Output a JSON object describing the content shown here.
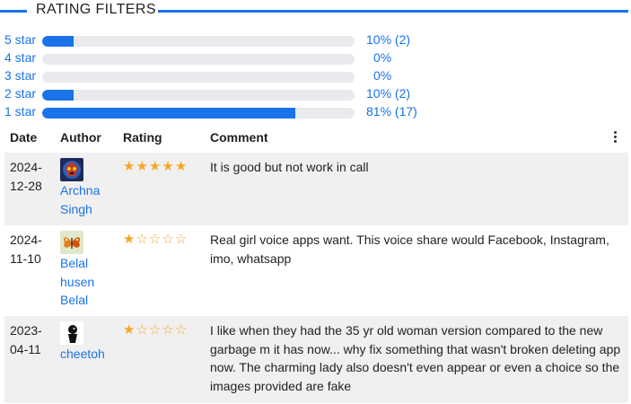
{
  "filters": {
    "title": "RATING FILTERS",
    "rows": [
      {
        "label": "5 star",
        "percent_text": "10% (2)",
        "fraction": 0.1
      },
      {
        "label": "4 star",
        "percent_text": "0%",
        "fraction": 0
      },
      {
        "label": "3 star",
        "percent_text": "0%",
        "fraction": 0
      },
      {
        "label": "2 star",
        "percent_text": "10% (2)",
        "fraction": 0.1
      },
      {
        "label": "1 star",
        "percent_text": "81% (17)",
        "fraction": 0.81
      }
    ],
    "accent_color": "#1a73e8"
  },
  "table": {
    "headers": {
      "date": "Date",
      "author": "Author",
      "rating": "Rating",
      "comment": "Comment"
    },
    "menu_icon": "more-vert-icon",
    "reviews": [
      {
        "date_line1": "2024-",
        "date_line2": "12-28",
        "author": "Archna Singh",
        "avatar_icon": "decorative-mask-avatar",
        "stars": 5,
        "comment": "It is good but not work in call"
      },
      {
        "date_line1": "2024-",
        "date_line2": "11-10",
        "author": "Belal husen Belal",
        "avatar_icon": "butterfly-avatar",
        "stars": 1,
        "comment": "Real girl voice apps want. This voice share would Facebook, Instagram, imo, whatsapp"
      },
      {
        "date_line1": "2023-",
        "date_line2": "04-11",
        "author": "cheetoh",
        "avatar_icon": "character-avatar",
        "stars": 1,
        "comment": "I like when they had the 35 yr old woman version compared to the new garbage m it has now... why fix something that wasn't broken deleting app now. The charming lady also doesn't even appear or even a choice so the images provided are fake"
      }
    ],
    "star_color": "#f5a623"
  }
}
